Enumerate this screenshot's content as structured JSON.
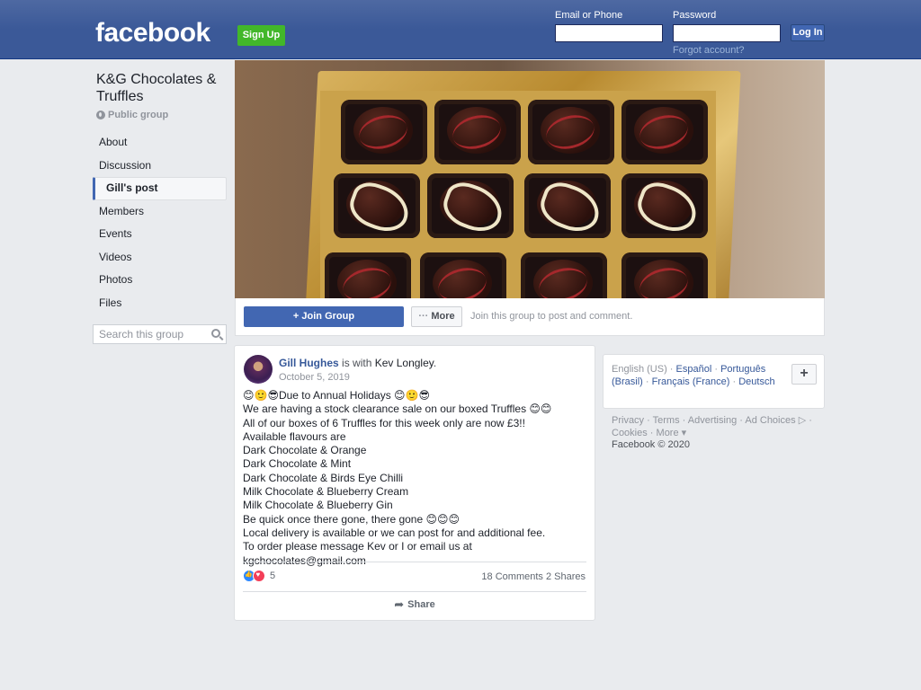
{
  "header": {
    "logo": "facebook",
    "signup_label": "Sign Up",
    "email_label": "Email or Phone",
    "password_label": "Password",
    "login_label": "Log In",
    "forgot_label": "Forgot account?"
  },
  "group": {
    "title": "K&G Chocolates & Truffles",
    "privacy": "Public group"
  },
  "sidebar": {
    "items": [
      {
        "label": "About"
      },
      {
        "label": "Discussion"
      },
      {
        "label": "Gill's post"
      },
      {
        "label": "Members"
      },
      {
        "label": "Events"
      },
      {
        "label": "Videos"
      },
      {
        "label": "Photos"
      },
      {
        "label": "Files"
      }
    ],
    "active_index": 2,
    "search_placeholder": "Search this group"
  },
  "join_bar": {
    "join_label": "Join Group",
    "more_label": "More",
    "hint": "Join this group to post and comment."
  },
  "post": {
    "author": "Gill Hughes",
    "with_text": "is with",
    "tagged": "Kev Longley",
    "date": "October 5, 2019",
    "lines": [
      "😊🙂😎Due to Annual Holidays 😊🙂😎",
      "We are having a stock clearance sale on our boxed Truffles 😊😊",
      "All of our boxes of 6 Truffles for this week only are now £3!!",
      "Available flavours are",
      "Dark Chocolate & Orange",
      "Dark Chocolate & Mint",
      "Dark Chocolate & Birds Eye Chilli",
      "Milk Chocolate & Blueberry Cream",
      "Milk Chocolate & Blueberry Gin",
      "Be quick once there gone, there gone 😊😊😊",
      "Local delivery is available or we can post for and additional fee.",
      "To order please message Kev or I or email us at kgchocolates@gmail.com"
    ],
    "reaction_count": "5",
    "comments": "18 Comments",
    "shares": "2 Shares",
    "share_label": "Share"
  },
  "languages": {
    "current": "English (US)",
    "others": [
      "Español",
      "Português (Brasil)",
      "Français (France)",
      "Deutsch"
    ]
  },
  "footer": {
    "links": [
      "Privacy",
      "Terms",
      "Advertising",
      "Ad Choices",
      "Cookies",
      "More"
    ],
    "copyright": "Facebook © 2020"
  },
  "colors": {
    "brand": "#3b5998",
    "button": "#4267b2",
    "signup": "#42b72a",
    "background": "#e9ebee"
  }
}
